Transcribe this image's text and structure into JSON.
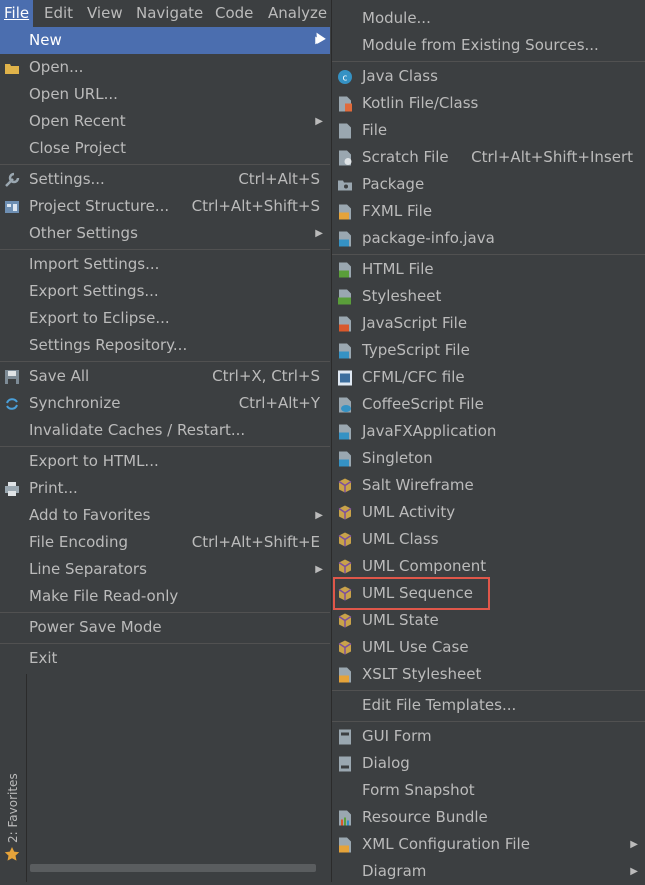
{
  "menubar": {
    "file": "File",
    "edit": "Edit",
    "view": "View",
    "navigate": "Navigate",
    "code": "Code",
    "analyze": "Analyze"
  },
  "file_menu": {
    "new": "New",
    "open": "Open...",
    "open_url": "Open URL...",
    "open_recent": "Open Recent",
    "close_project": "Close Project",
    "settings": "Settings...",
    "settings_sc": "Ctrl+Alt+S",
    "project_structure": "Project Structure...",
    "project_structure_sc": "Ctrl+Alt+Shift+S",
    "other_settings": "Other Settings",
    "import_settings": "Import Settings...",
    "export_settings": "Export Settings...",
    "export_eclipse": "Export to Eclipse...",
    "settings_repo": "Settings Repository...",
    "save_all": "Save All",
    "save_all_sc": "Ctrl+X, Ctrl+S",
    "synchronize": "Synchronize",
    "synchronize_sc": "Ctrl+Alt+Y",
    "invalidate": "Invalidate Caches / Restart...",
    "export_html": "Export to HTML...",
    "print": "Print...",
    "add_favorites": "Add to Favorites",
    "file_encoding": "File Encoding",
    "file_encoding_sc": "Ctrl+Alt+Shift+E",
    "line_separators": "Line Separators",
    "make_readonly": "Make File Read-only",
    "power_save": "Power Save Mode",
    "exit": "Exit"
  },
  "new_menu": {
    "module": "Module...",
    "module_existing": "Module from Existing Sources...",
    "java_class": "Java Class",
    "kotlin": "Kotlin File/Class",
    "file": "File",
    "scratch": "Scratch File",
    "scratch_sc": "Ctrl+Alt+Shift+Insert",
    "package": "Package",
    "fxml": "FXML File",
    "package_info": "package-info.java",
    "html": "HTML File",
    "stylesheet": "Stylesheet",
    "javascript": "JavaScript File",
    "typescript": "TypeScript File",
    "cfml": "CFML/CFC file",
    "coffeescript": "CoffeeScript File",
    "javafx": "JavaFXApplication",
    "singleton": "Singleton",
    "salt": "Salt Wireframe",
    "uml_activity": "UML Activity",
    "uml_class": "UML Class",
    "uml_component": "UML Component",
    "uml_sequence": "UML Sequence",
    "uml_state": "UML State",
    "uml_usecase": "UML Use Case",
    "xslt": "XSLT Stylesheet",
    "edit_templates": "Edit File Templates...",
    "gui_form": "GUI Form",
    "dialog": "Dialog",
    "form_snapshot": "Form Snapshot",
    "resource_bundle": "Resource Bundle",
    "xml_config": "XML Configuration File",
    "diagram": "Diagram"
  },
  "sidebar": {
    "favorites": "2: Favorites"
  },
  "colors": {
    "selection": "#4b6eaf",
    "background": "#3c3f41",
    "highlight_border": "#e0574a"
  }
}
